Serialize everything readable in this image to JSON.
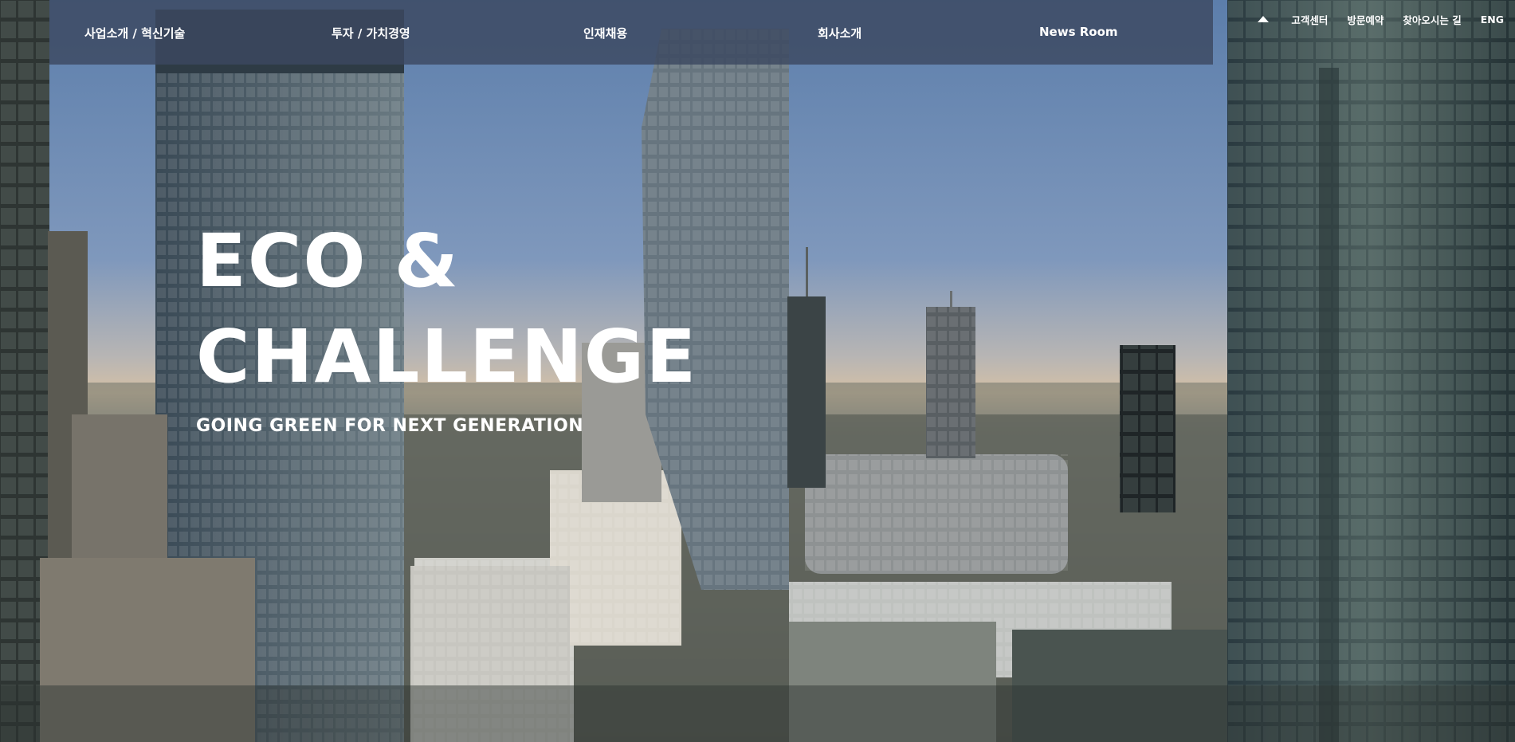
{
  "nav": {
    "items": [
      {
        "label": "사업소개 / 혁신기술"
      },
      {
        "label": "투자 / 가치경영"
      },
      {
        "label": "인재채용"
      },
      {
        "label": "회사소개"
      },
      {
        "label": "News Room"
      }
    ]
  },
  "utility": {
    "customer_center": "고객센터",
    "visit_reservation": "방문예약",
    "directions": "찾아오시는 길",
    "language": "ENG"
  },
  "hero": {
    "title_line1": "ECO &",
    "title_line2": "CHALLENGE",
    "subtitle": "GOING GREEN FOR NEXT GENERATION"
  },
  "colors": {
    "sky_top": "#6f8db4",
    "sky_horizon": "#c9bfae",
    "nav_bg": "#3c4860"
  }
}
